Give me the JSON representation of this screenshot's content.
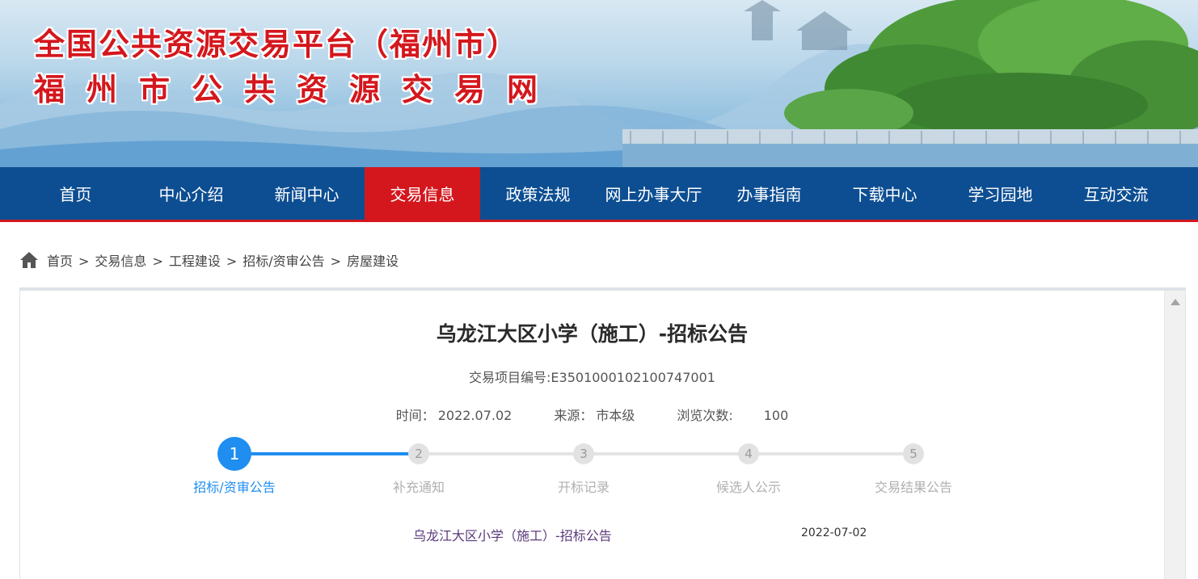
{
  "banner": {
    "title_line1": "全国公共资源交易平台（福州市）",
    "title_line2": "福州市公共资源交易网"
  },
  "nav": {
    "items": [
      {
        "label": "首页"
      },
      {
        "label": "中心介绍"
      },
      {
        "label": "新闻中心"
      },
      {
        "label": "交易信息",
        "active": true
      },
      {
        "label": "政策法规"
      },
      {
        "label": "网上办事大厅"
      },
      {
        "label": "办事指南"
      },
      {
        "label": "下载中心"
      },
      {
        "label": "学习园地"
      },
      {
        "label": "互动交流"
      }
    ]
  },
  "breadcrumb": {
    "icon": "home-icon",
    "items": [
      "首页",
      "交易信息",
      "工程建设",
      "招标/资审公告",
      "房屋建设"
    ],
    "separator": ">"
  },
  "article": {
    "title": "乌龙江大区小学（施工）-招标公告",
    "code": "交易项目编号:E3501000102100747001",
    "time_label": "时间：",
    "time_value": "2022.07.02",
    "source_label": "来源：",
    "source_value": "市本级",
    "views_label": "浏览次数:",
    "views_value": "100"
  },
  "steps": {
    "current": 1,
    "items": [
      {
        "num": "1",
        "label": "招标/资审公告"
      },
      {
        "num": "2",
        "label": "补充通知"
      },
      {
        "num": "3",
        "label": "开标记录"
      },
      {
        "num": "4",
        "label": "候选人公示"
      },
      {
        "num": "5",
        "label": "交易结果公告"
      }
    ]
  },
  "list": {
    "rows": [
      {
        "title": "乌龙江大区小学（施工）-招标公告",
        "date": "2022-07-02"
      }
    ]
  },
  "colors": {
    "nav_bg": "#0d4e92",
    "accent_red": "#d4171d",
    "step_blue": "#1f8ef0"
  }
}
